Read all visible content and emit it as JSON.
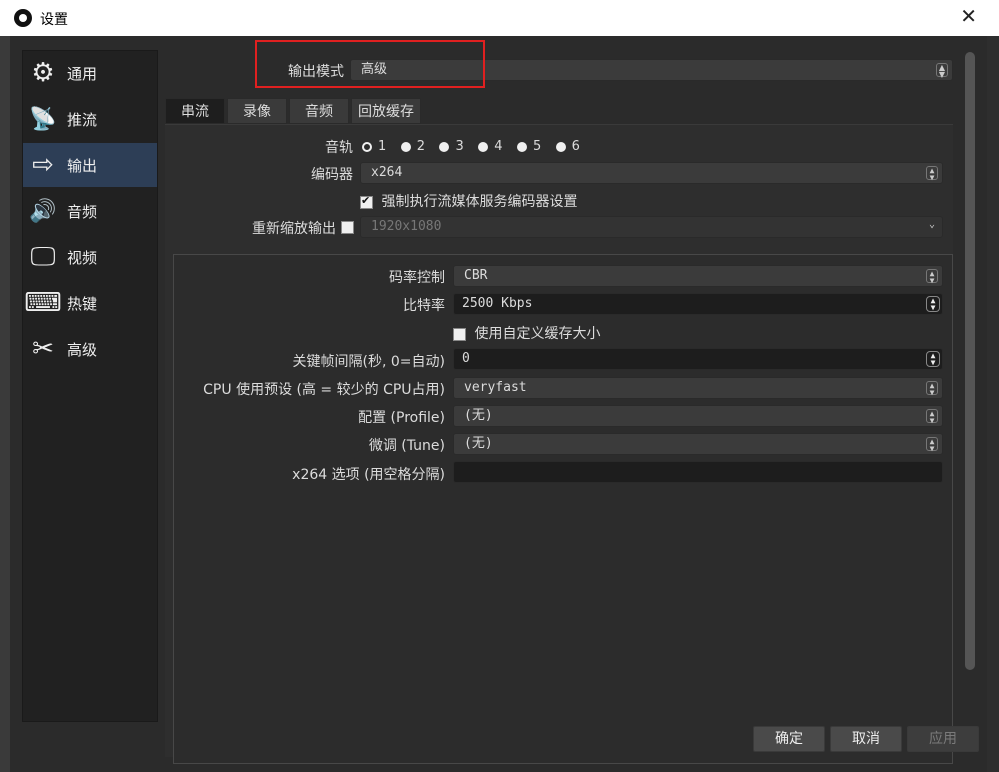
{
  "window": {
    "title": "设置",
    "close_glyph": "✕"
  },
  "sidebar": {
    "items": [
      {
        "label": "通用",
        "icon": "gear-icon",
        "glyph": "⚙",
        "active": false
      },
      {
        "label": "推流",
        "icon": "antenna-icon",
        "glyph": "📡",
        "active": false
      },
      {
        "label": "输出",
        "icon": "output-icon",
        "glyph": "⇨",
        "active": true
      },
      {
        "label": "音频",
        "icon": "speaker-icon",
        "glyph": "🔊",
        "active": false
      },
      {
        "label": "视频",
        "icon": "monitor-icon",
        "glyph": "🖵",
        "active": false
      },
      {
        "label": "热键",
        "icon": "keyboard-icon",
        "glyph": "⌨",
        "active": false
      },
      {
        "label": "高级",
        "icon": "tools-icon",
        "glyph": "✂",
        "active": false
      }
    ]
  },
  "output_mode": {
    "label": "输出模式",
    "value": "高级"
  },
  "tabs": [
    {
      "label": "串流",
      "active": true
    },
    {
      "label": "录像",
      "active": false
    },
    {
      "label": "音频",
      "active": false
    },
    {
      "label": "回放缓存",
      "active": false
    }
  ],
  "streaming": {
    "track_label": "音轨",
    "tracks": [
      "1",
      "2",
      "3",
      "4",
      "5",
      "6"
    ],
    "selected_track": "1",
    "encoder_label": "编码器",
    "encoder_value": "x264",
    "enforce_label": "强制执行流媒体服务编码器设置",
    "enforce_checked": true,
    "rescale_label": "重新缩放输出",
    "rescale_checked": false,
    "rescale_value": "1920x1080"
  },
  "encoder_settings": {
    "rate_control_label": "码率控制",
    "rate_control_value": "CBR",
    "bitrate_label": "比特率",
    "bitrate_value": "2500 Kbps",
    "custom_buffer_label": "使用自定义缓存大小",
    "custom_buffer_checked": false,
    "keyframe_label": "关键帧间隔(秒, 0=自动)",
    "keyframe_value": "0",
    "preset_label": "CPU 使用预设 (高 = 较少的 CPU占用)",
    "preset_value": "veryfast",
    "profile_label": "配置 (Profile)",
    "profile_value": "(无)",
    "tune_label": "微调 (Tune)",
    "tune_value": "(无)",
    "x264opts_label": "x264 选项 (用空格分隔)",
    "x264opts_value": ""
  },
  "buttons": {
    "ok": "确定",
    "cancel": "取消",
    "apply": "应用"
  },
  "colors": {
    "accent_active": "#2d3e56",
    "highlight_box": "#e02020"
  }
}
